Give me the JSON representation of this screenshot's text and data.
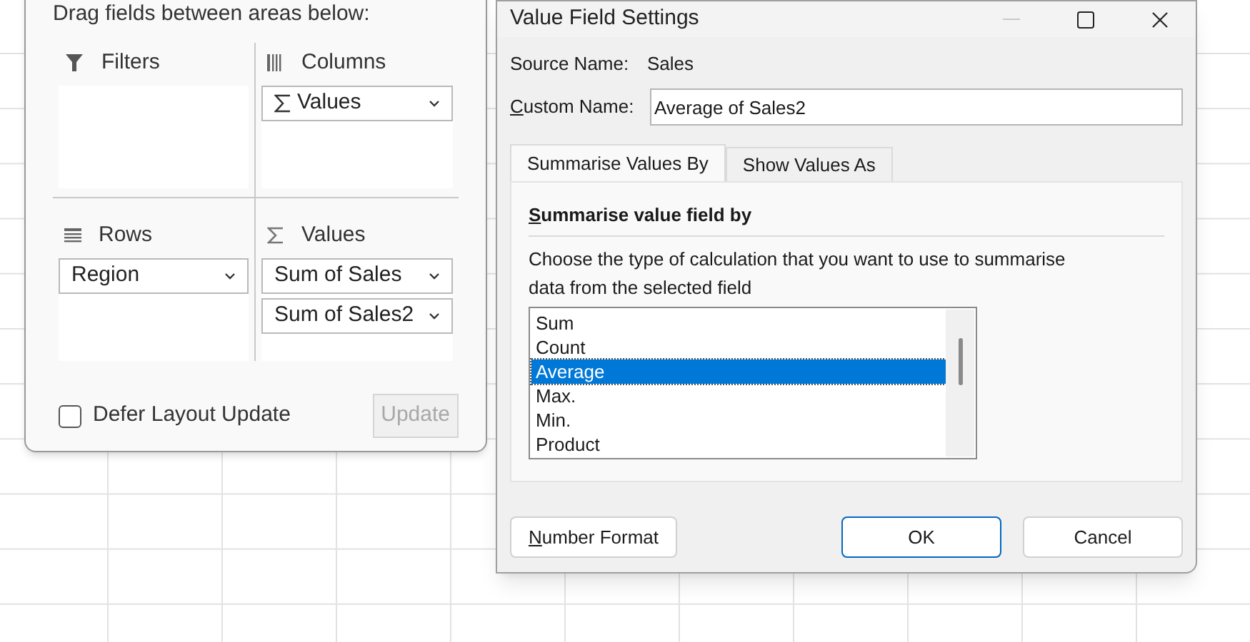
{
  "field_list": {
    "instruction": "Drag fields between areas below:",
    "areas": [
      {
        "kind": "filters",
        "label": "Filters"
      },
      {
        "kind": "columns",
        "label": "Columns",
        "fields": [
          {
            "label": "Values",
            "sigma": true
          }
        ]
      },
      {
        "kind": "rows",
        "label": "Rows",
        "fields": [
          {
            "label": "Region",
            "sigma": false
          }
        ]
      },
      {
        "kind": "values",
        "label": "Values",
        "fields": [
          {
            "label": "Sum of Sales",
            "sigma": false
          },
          {
            "label": "Sum of Sales2",
            "sigma": false
          }
        ]
      }
    ],
    "defer": {
      "label": "Defer Layout Update",
      "checked": false
    },
    "update_button": {
      "label": "Update",
      "disabled": true
    }
  },
  "dialog": {
    "title": "Value Field Settings",
    "source_name": {
      "label": "Source Name:",
      "value": "Sales"
    },
    "custom_name": {
      "label": "Custom Name:",
      "value": "Average of Sales2",
      "underline_first": true
    },
    "tabs": [
      {
        "label": "Summarise Values By",
        "selected": true
      },
      {
        "label": "Show Values As",
        "selected": false
      }
    ],
    "heading": {
      "text": "Summarise value field by",
      "underline_first": true
    },
    "description": "Choose the type of calculation that you want to use to summarise data from the selected field",
    "functions": [
      {
        "label": "Sum",
        "selected": false
      },
      {
        "label": "Count",
        "selected": false
      },
      {
        "label": "Average",
        "selected": true
      },
      {
        "label": "Max.",
        "selected": false
      },
      {
        "label": "Min.",
        "selected": false
      },
      {
        "label": "Product",
        "selected": false
      }
    ],
    "buttons": [
      {
        "label": "Number Format",
        "kind": "secondary",
        "underline_first": true
      },
      {
        "label": "OK",
        "kind": "default",
        "underline_first": false
      },
      {
        "label": "Cancel",
        "kind": "secondary",
        "underline_first": false
      }
    ]
  }
}
